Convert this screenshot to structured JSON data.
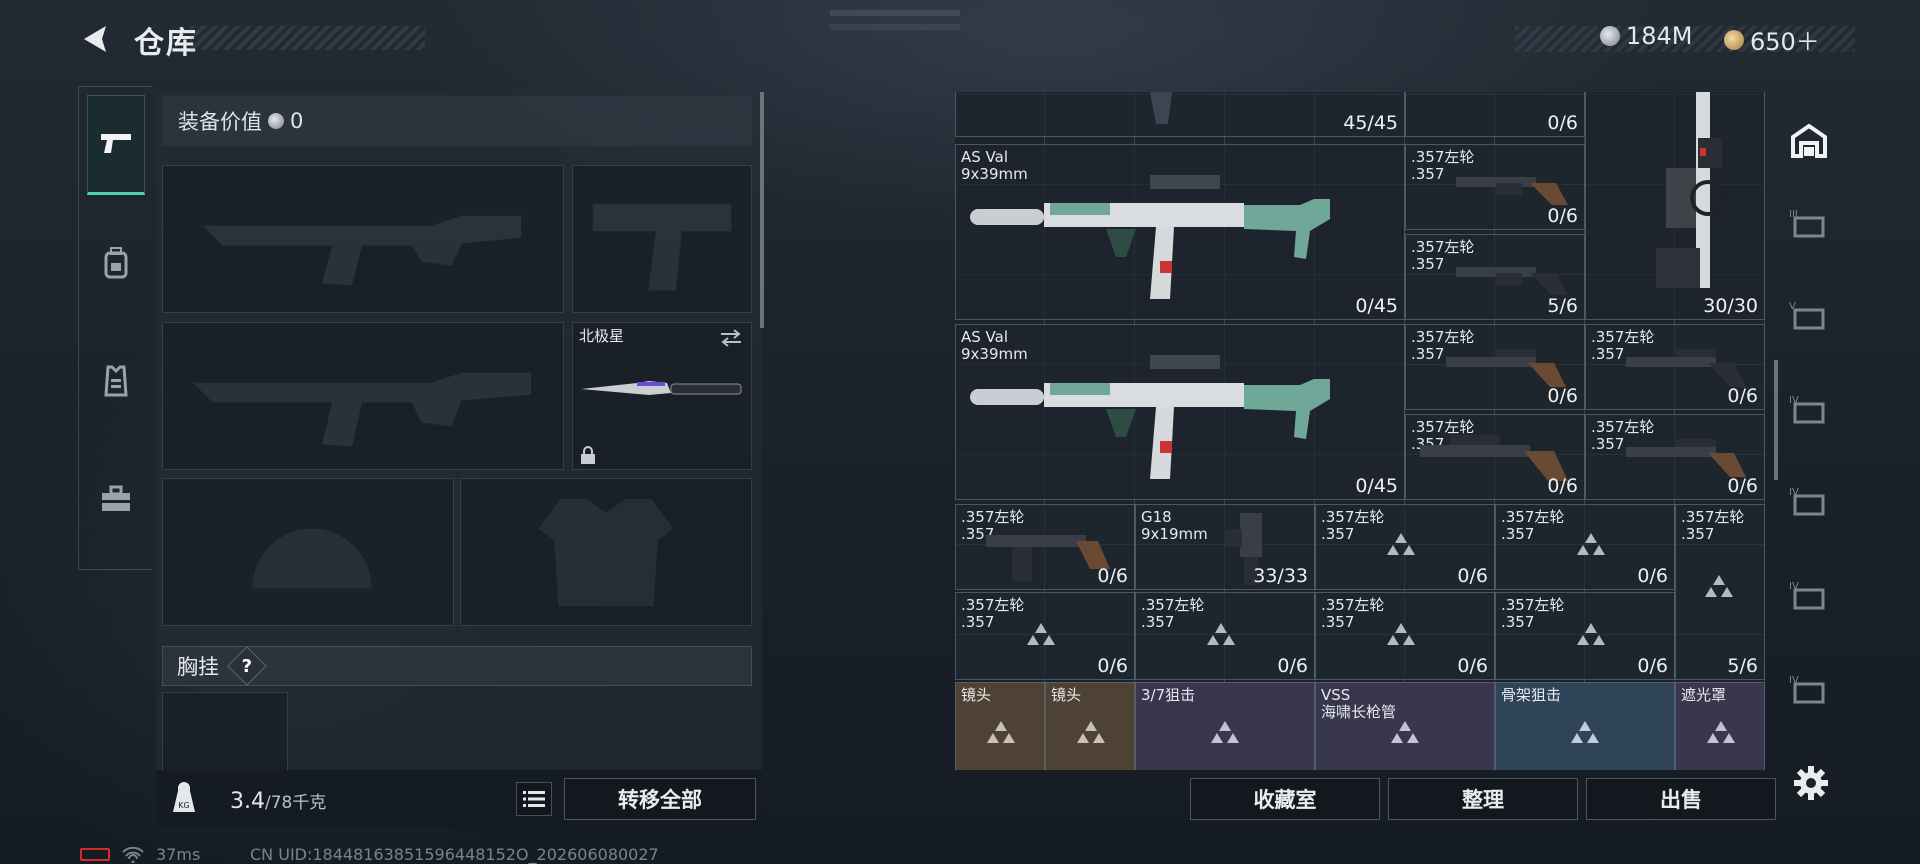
{
  "header": {
    "title": "仓库",
    "currency_silver": "184M",
    "currency_gold": "650＋"
  },
  "loadout": {
    "value_label": "装备价值",
    "value": "0",
    "knife_name": "北极星",
    "chest_label": "胸挂",
    "chest_help": "?",
    "weight_current": "3.4",
    "weight_max": "/78千克",
    "transfer_all": "转移全部"
  },
  "status": {
    "ping": "37ms",
    "uid": "CN UID:18448163851596448152O_202606080027"
  },
  "grid": {
    "top_counts": [
      "45/45",
      "0/6"
    ],
    "items": [
      {
        "name": "AS Val\n9x39mm",
        "count": "0/45"
      },
      {
        "name": "AS Val\n9x39mm",
        "count": "0/45"
      },
      {
        "name": ".357左轮\n.357",
        "count": "0/6"
      },
      {
        "name": ".357左轮\n.357",
        "count": "5/6"
      },
      {
        "name": ".357左轮\n.357",
        "count": "0/6"
      },
      {
        "name": ".357左轮\n.357",
        "count": "0/6"
      },
      {
        "name": ".357左轮\n.357",
        "count": "0/6"
      },
      {
        "name": ".357左轮\n.357",
        "count": "0/6"
      },
      {
        "name": "",
        "count": "30/30"
      },
      {
        "name": ".357左轮\n.357",
        "count": "0/6"
      },
      {
        "name": "G18\n9x19mm",
        "count": "33/33"
      },
      {
        "name": ".357左轮\n.357",
        "count": "0/6"
      },
      {
        "name": ".357左轮\n.357",
        "count": "0/6"
      },
      {
        "name": ".357左轮\n.357",
        "count": ""
      },
      {
        "name": ".357左轮\n.357",
        "count": "0/6"
      },
      {
        "name": ".357左轮\n.357",
        "count": "0/6"
      },
      {
        "name": ".357左轮\n.357",
        "count": "0/6"
      },
      {
        "name": ".357左轮\n.357",
        "count": "0/6"
      },
      {
        "name": "",
        "count": "5/6"
      },
      {
        "name": "镜头",
        "count": ""
      },
      {
        "name": "镜头",
        "count": ""
      },
      {
        "name": "3/7狙击",
        "count": ""
      },
      {
        "name": "VSS\n海啸长枪管",
        "count": ""
      },
      {
        "name": "骨架狙击",
        "count": ""
      },
      {
        "name": "遮光罩",
        "count": ""
      }
    ]
  },
  "buttons": {
    "collection": "收藏室",
    "organize": "整理",
    "sell": "出售"
  },
  "icons": [
    "back-arrow-icon",
    "silver-coin-icon",
    "gold-coin-icon",
    "pistol-icon",
    "backpack-icon",
    "vest-icon",
    "toolbox-icon",
    "kg-weight-icon",
    "list-icon",
    "swap-icon",
    "lock-icon",
    "rarity-triangle-icon",
    "warehouse-icon",
    "gear-icon"
  ],
  "colors": {
    "accent": "#4fd1b5",
    "rarity_gold_bg": "#5a4a33",
    "rarity_purple_bg": "#3c3a55",
    "rarity_blue_bg": "#2f4558"
  }
}
